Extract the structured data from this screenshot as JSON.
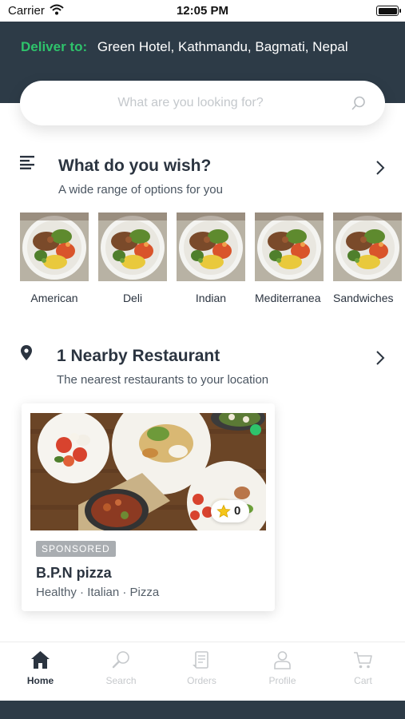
{
  "status_bar": {
    "carrier": "Carrier",
    "time": "12:05 PM"
  },
  "header": {
    "deliver_label": "Deliver to:",
    "address": "Green Hotel, Kathmandu, Bagmati, Nepal"
  },
  "search": {
    "placeholder": "What are you looking for?"
  },
  "wish_section": {
    "title": "What do you wish?",
    "subtitle": "A wide range of options for you",
    "categories": [
      {
        "label": "American"
      },
      {
        "label": "Deli"
      },
      {
        "label": "Indian"
      },
      {
        "label": "Mediterranea"
      },
      {
        "label": "Sandwiches"
      }
    ]
  },
  "nearby_section": {
    "title": "1 Nearby Restaurant",
    "subtitle": "The nearest restaurants to your location"
  },
  "restaurant": {
    "badge": "SPONSORED",
    "name": "B.P.N pizza",
    "tags": "Healthy · Italian · Pizza",
    "rating": "0"
  },
  "tabs": [
    {
      "label": "Home",
      "icon": "home-icon",
      "active": true
    },
    {
      "label": "Search",
      "icon": "search-icon",
      "active": false
    },
    {
      "label": "Orders",
      "icon": "orders-icon",
      "active": false
    },
    {
      "label": "Profile",
      "icon": "profile-icon",
      "active": false
    },
    {
      "label": "Cart",
      "icon": "cart-icon",
      "active": false
    }
  ],
  "colors": {
    "header_bg": "#2d3b47",
    "accent_green": "#2ec36b",
    "text_dark": "#2b3440"
  }
}
